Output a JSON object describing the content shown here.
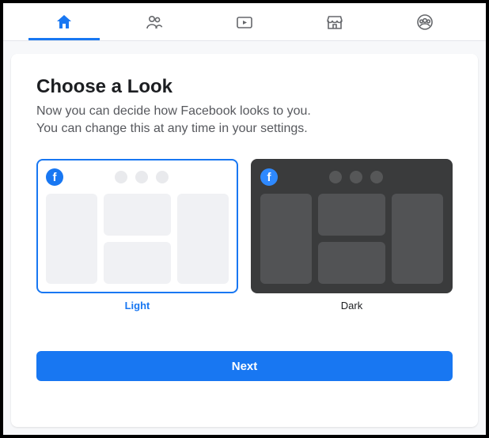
{
  "nav": {
    "items": [
      "home",
      "friends",
      "watch",
      "marketplace",
      "groups"
    ],
    "active": "home"
  },
  "dialog": {
    "title": "Choose a Look",
    "subtitle_line1": "Now you can decide how Facebook looks to you.",
    "subtitle_line2": "You can change this at any time in your settings.",
    "options": {
      "light": {
        "label": "Light",
        "selected": true
      },
      "dark": {
        "label": "Dark",
        "selected": false
      }
    },
    "next_label": "Next"
  },
  "colors": {
    "accent": "#1877f2",
    "dark_panel": "#3a3b3c"
  }
}
